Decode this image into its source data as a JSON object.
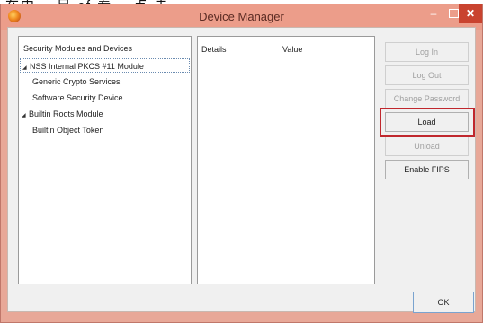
{
  "caption": "在中 ，另 cf 看 ，点 击",
  "window": {
    "title": "Device Manager",
    "minimize_glyph": "–",
    "close_glyph": "✕"
  },
  "tree": {
    "header": "Security Modules and Devices",
    "items": [
      {
        "label": "NSS Internal PKCS #11 Module",
        "expanded": true,
        "selected": true
      },
      {
        "label": "Generic Crypto Services"
      },
      {
        "label": "Software Security Device"
      },
      {
        "label": "Builtin Roots Module",
        "expanded": true
      },
      {
        "label": "Builtin Object Token"
      }
    ],
    "expander_glyph": "◢"
  },
  "details": {
    "columns": [
      "Details",
      "Value"
    ]
  },
  "buttons": {
    "log_in": "Log In",
    "log_out": "Log Out",
    "change_password": "Change Password",
    "load": "Load",
    "unload": "Unload",
    "enable_fips": "Enable FIPS",
    "ok": "OK"
  },
  "colors": {
    "title_bar": "#ec9d8a",
    "close_button": "#c9432f",
    "highlight": "#c0272d"
  }
}
